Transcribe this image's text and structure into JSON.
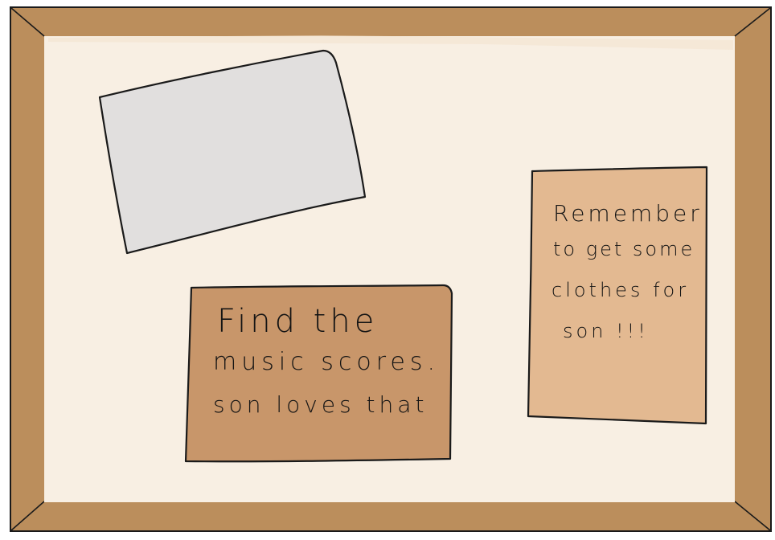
{
  "colors": {
    "frame": "#bb8e5c",
    "frame_edge": "#1a1a1a",
    "board": "#f8efe3",
    "blank_paper": "#e1dfde",
    "note_music": "#c8966a",
    "note_clothes": "#e3b991"
  },
  "notes": {
    "music": {
      "lines": [
        "Find the",
        "music scores.",
        "son loves that"
      ]
    },
    "clothes": {
      "lines": [
        "Remember",
        "to get some",
        "clothes for",
        "son !!!"
      ]
    }
  }
}
